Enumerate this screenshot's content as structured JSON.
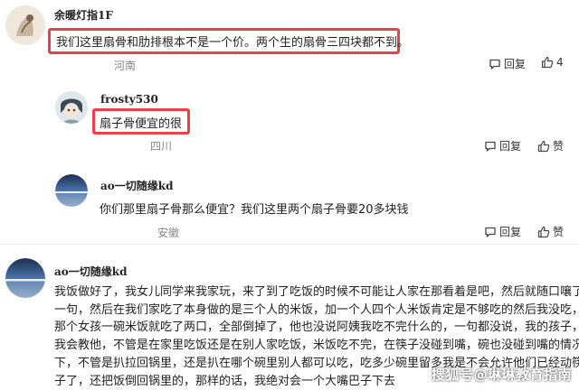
{
  "comments": [
    {
      "username": "余暖灯指1F",
      "content": "我们这里扇骨和肋排根本不是一个价。两个生的扇骨三四块都不到。",
      "location": "河南",
      "reply_label": "回复",
      "like_count": "4"
    },
    {
      "username": "frosty530",
      "content": "扇子骨便宜的很",
      "location": "四川",
      "reply_label": "回复",
      "like_label": "赞"
    },
    {
      "username": "ao一切随缘kd",
      "content": "你们那里扇子骨那么便宜？我们这里两个扇子骨要20多块钱",
      "location": "安徽",
      "reply_label": "回复",
      "like_label": "赞"
    },
    {
      "username": "ao一切随缘kd",
      "lines": [
        "我饭做好了，我女儿同学来我家玩，来了到了吃饭的时候不可能让人家在那看着是吧，然后就随口嚷了",
        "一句，然后在我们家吃了本身做的是三个人的米饭，加一个人四个人米饭肯定是不够吃的然后我没吃，",
        "那个女孩一碗米饭就吃了两口，全部倒掉了，他也没说阿姨我吃不完什么的，一句都没说，我的孩子，",
        "我会教他，不管是在家里吃饭还是在别人家吃饭，米饭吃不完，在筷子没碰到嘴，碗也没碰到嘴的情况",
        "下，不管是扒拉回锅里，还是扒在哪个碗里别人都可以吃，吃多少碗里留多我是不会允许他们已经动筷",
        "子了，还把饭倒回锅里的，那样的话，我绝对会一个大嘴巴子下去"
      ]
    }
  ],
  "watermark": "搜狐号@琳琳教育指南",
  "colors": {
    "highlight": "#e8414a",
    "muted": "#888888",
    "text": "#222222"
  }
}
